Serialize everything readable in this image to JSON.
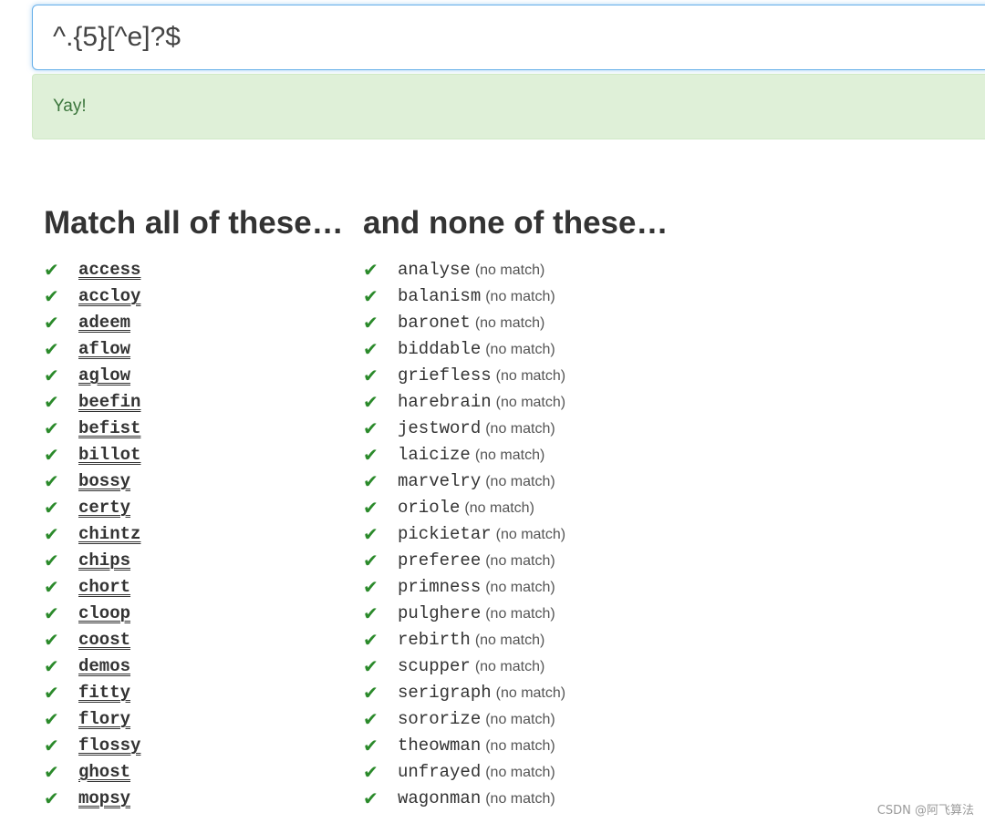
{
  "regex": {
    "value": "^.{5}[^e]?$"
  },
  "status": {
    "message": "Yay!"
  },
  "colors": {
    "check": "#2b8a2b",
    "alert_bg": "#dff0d8",
    "alert_text": "#3c763d",
    "input_focus_border": "#66afe9"
  },
  "match_column": {
    "heading": "Match all of these…",
    "icon": "check-icon",
    "words": [
      "access",
      "accloy",
      "adeem",
      "aflow",
      "aglow",
      "beefin",
      "befist",
      "billot",
      "bossy",
      "certy",
      "chintz",
      "chips",
      "chort",
      "cloop",
      "coost",
      "demos",
      "fitty",
      "flory",
      "flossy",
      "ghost",
      "mopsy"
    ]
  },
  "nonmatch_column": {
    "heading": "and none of these…",
    "icon": "check-icon",
    "suffix": "(no match)",
    "words": [
      "analyse",
      "balanism",
      "baronet",
      "biddable",
      "griefless",
      "harebrain",
      "jestword",
      "laicize",
      "marvelry",
      "oriole",
      "pickietar",
      "preferee",
      "primness",
      "pulghere",
      "rebirth",
      "scupper",
      "serigraph",
      "sororize",
      "theowman",
      "unfrayed",
      "wagonman"
    ]
  },
  "watermark": "CSDN @阿飞算法"
}
